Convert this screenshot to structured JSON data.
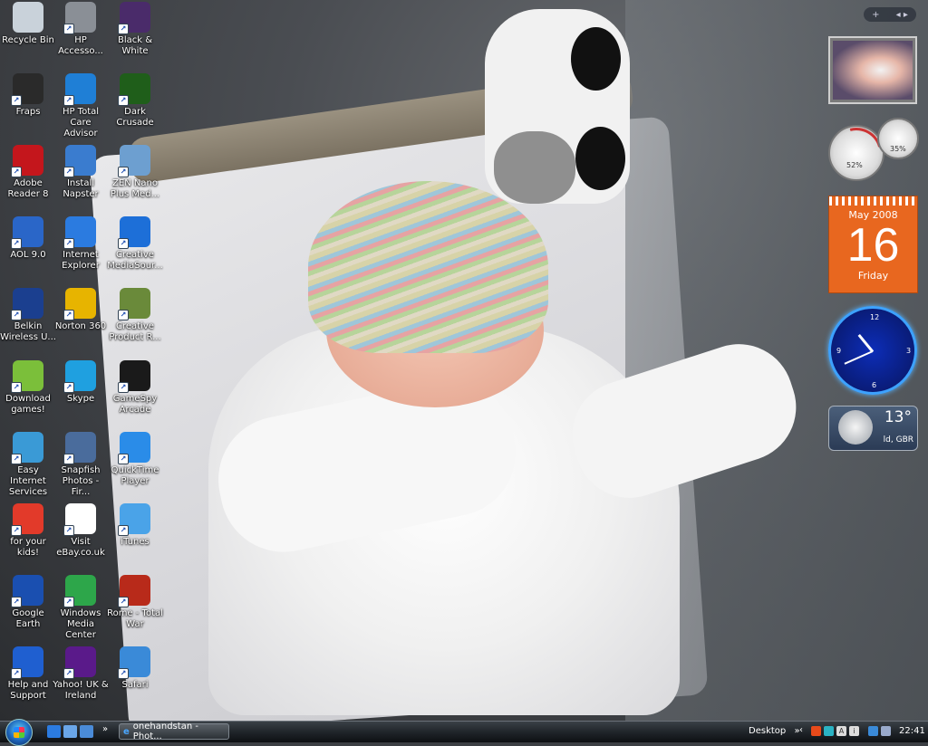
{
  "desktop": {
    "icons": [
      {
        "label": "Recycle Bin",
        "icon": "recycle-bin-icon",
        "color": "#c9d2da"
      },
      {
        "label": "HP Accesso...",
        "icon": "hp-accessories-icon",
        "color": "#8a8f96"
      },
      {
        "label": "Black & White",
        "icon": "black-and-white-icon",
        "color": "#4a2b6a"
      },
      {
        "label": "Fraps",
        "icon": "fraps-icon",
        "color": "#2a2a2a"
      },
      {
        "label": "HP Total Care Advisor",
        "icon": "hp-total-care-icon",
        "color": "#1f7fd6"
      },
      {
        "label": "Dark Crusade",
        "icon": "dark-crusade-icon",
        "color": "#1f5e1a"
      },
      {
        "label": "Adobe Reader 8",
        "icon": "adobe-reader-icon",
        "color": "#c4161c"
      },
      {
        "label": "Install Napster",
        "icon": "napster-icon",
        "color": "#3a7ccf"
      },
      {
        "label": "ZEN Nano Plus Med...",
        "icon": "zen-nano-icon",
        "color": "#6d9fd0"
      },
      {
        "label": "AOL 9.0",
        "icon": "aol-icon",
        "color": "#2a66c8"
      },
      {
        "label": "Internet Explorer",
        "icon": "internet-explorer-icon",
        "color": "#2b7be0"
      },
      {
        "label": "Creative MediaSour...",
        "icon": "creative-mediasource-icon",
        "color": "#1d6fd8"
      },
      {
        "label": "Belkin Wireless U...",
        "icon": "belkin-wireless-icon",
        "color": "#1b3f8f"
      },
      {
        "label": "Norton 360",
        "icon": "norton-icon",
        "color": "#e7b400"
      },
      {
        "label": "Creative Product R...",
        "icon": "creative-product-icon",
        "color": "#6a8a3a"
      },
      {
        "label": "Download games!",
        "icon": "download-games-icon",
        "color": "#7bbf3a"
      },
      {
        "label": "Skype",
        "icon": "skype-icon",
        "color": "#1fa0e0"
      },
      {
        "label": "GameSpy Arcade",
        "icon": "gamespy-icon",
        "color": "#1a1a1a"
      },
      {
        "label": "Easy Internet Services",
        "icon": "easy-internet-icon",
        "color": "#3a9ad6"
      },
      {
        "label": "Snapfish Photos - Fir...",
        "icon": "snapfish-icon",
        "color": "#4a6c9c"
      },
      {
        "label": "QuickTime Player",
        "icon": "quicktime-icon",
        "color": "#2a8ce8"
      },
      {
        "label": "for your kids!",
        "icon": "for-your-kids-icon",
        "color": "#e23a2a"
      },
      {
        "label": "Visit eBay.co.uk",
        "icon": "ebay-icon",
        "color": "#ffffff"
      },
      {
        "label": "iTunes",
        "icon": "itunes-icon",
        "color": "#4aa3e8"
      },
      {
        "label": "Google Earth",
        "icon": "google-earth-icon",
        "color": "#1a4fb0"
      },
      {
        "label": "Windows Media Center",
        "icon": "windows-media-center-icon",
        "color": "#2da64a"
      },
      {
        "label": "Rome - Total War",
        "icon": "rome-total-war-icon",
        "color": "#b82a1a"
      },
      {
        "label": "Help and Support",
        "icon": "help-support-icon",
        "color": "#1f5fd0"
      },
      {
        "label": "Yahoo! UK & Ireland",
        "icon": "yahoo-icon",
        "color": "#5a1a8a"
      },
      {
        "label": "Safari",
        "icon": "safari-icon",
        "color": "#3a8ad8"
      }
    ]
  },
  "gadgets": {
    "toolbar": {
      "add": "+",
      "nav": "◂ ▸"
    },
    "cpu": {
      "cpu_percent": "52%",
      "mem_percent": "35%"
    },
    "calendar": {
      "month": "May 2008",
      "day": "16",
      "weekday": "Friday",
      "color": "#e8671f"
    },
    "clock": {
      "hour": 10,
      "minute": 41
    },
    "weather": {
      "temp": "13°",
      "location": "ld, GBR"
    }
  },
  "taskbar": {
    "task_label": "onehandstan - Phot...",
    "desktop_label": "Desktop",
    "chevron": "»",
    "tray_arrow": "‹",
    "time": "22:41"
  }
}
